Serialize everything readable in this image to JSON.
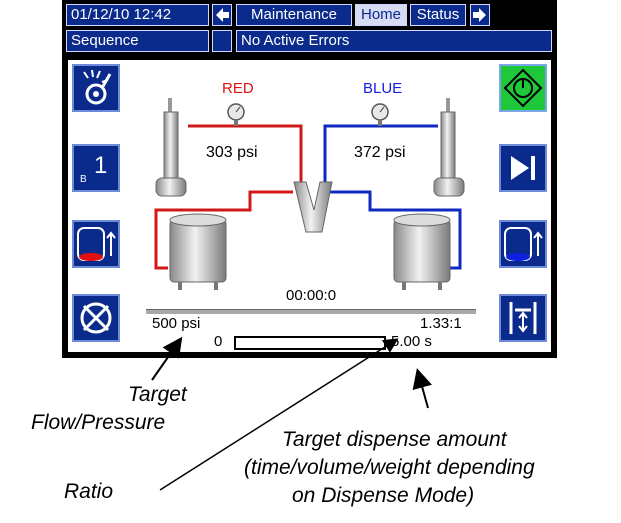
{
  "topbar": {
    "datetime": "01/12/10 12:42",
    "tab_maintenance": "Maintenance",
    "tab_home": "Home",
    "tab_status": "Status"
  },
  "statusbar": {
    "sequence": "Sequence",
    "errors": "No Active Errors"
  },
  "left_buttons": {
    "batch_number": "1",
    "batch_letter": "B"
  },
  "diagram": {
    "red_label": "RED",
    "blue_label": "BLUE",
    "red_pressure": "303 psi",
    "blue_pressure": "372 psi",
    "timer": "00:00:0"
  },
  "readouts": {
    "target_pressure": "500 psi",
    "ratio": "1.33:1",
    "progress_start": "0",
    "dispense_target": "5.00 s",
    "progress_fraction": 0
  },
  "captions": {
    "target_line1": "Target",
    "target_line2": "Flow/Pressure",
    "ratio": "Ratio",
    "dispense_line1": "Target dispense amount",
    "dispense_line2": "(time/volume/weight depending",
    "dispense_line3": "on Dispense Mode)"
  },
  "colors": {
    "screen_blue": "#0a2a8c",
    "red_line": "#d01818",
    "blue_line": "#1028c0",
    "start_green": "#1ec83a"
  }
}
